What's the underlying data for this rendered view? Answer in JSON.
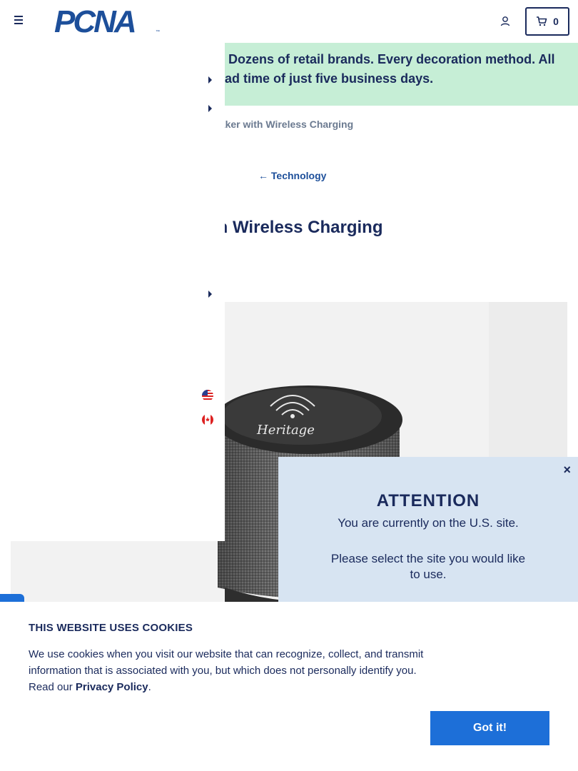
{
  "header": {
    "logo_text": "PCNA",
    "logo_tm": "™",
    "cart_count": "0"
  },
  "banner": {
    "text": "s. Dozens of retail brands. Every decoration method. All lead time of just five business days."
  },
  "breadcrumb": {
    "current": "eaker with Wireless Charging"
  },
  "back_link": {
    "label": "Technology",
    "arrow": "←"
  },
  "product": {
    "title": "ith Wireless Charging",
    "image_brand_text": "Heritage"
  },
  "attention": {
    "close": "×",
    "title": "ATTENTION",
    "message": "You are currently on the U.S. site.",
    "prompt": "Please select the site you would like to use."
  },
  "cookie": {
    "title": "THIS WEBSITE USES COOKIES",
    "text_before": "We use cookies when you visit our website that can recognize, collect, and transmit information that is associated with you, but which does not personally identify you. Read our ",
    "link": "Privacy Policy",
    "text_after": ".",
    "button": "Got it!"
  },
  "colors": {
    "navy": "#1a2a5c",
    "brand_blue": "#1d4f9a",
    "banner_green": "#c6eed6",
    "modal_blue": "#d7e4f2",
    "button_blue": "#1d6fd8"
  }
}
